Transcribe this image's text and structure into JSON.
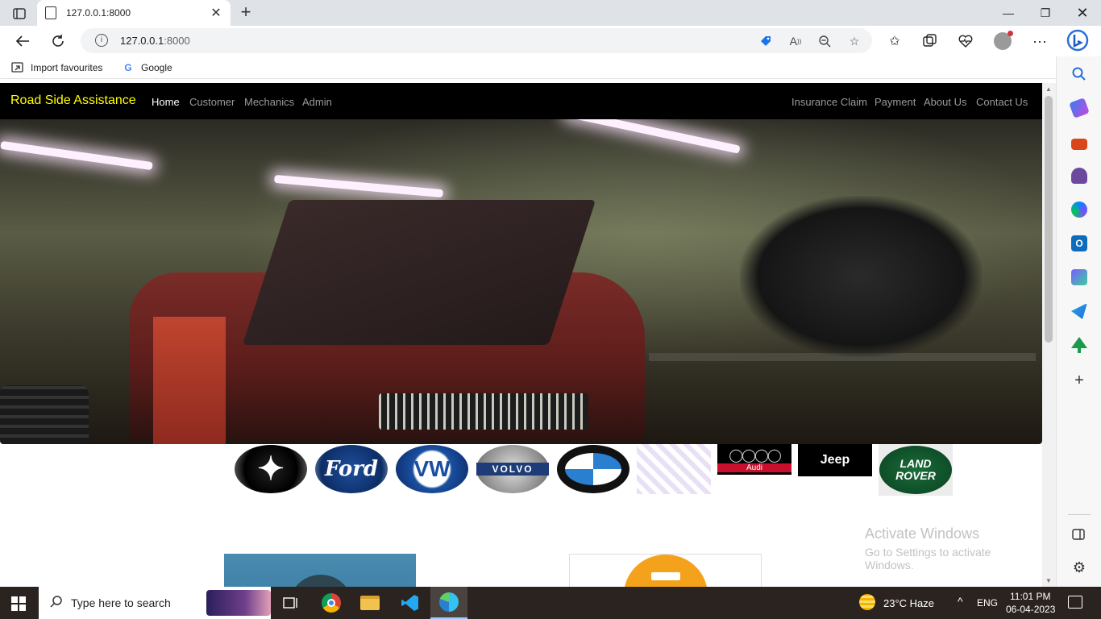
{
  "browser": {
    "tab_title": "127.0.0.1:8000",
    "url_host": "127.0.0.1",
    "url_port": ":8000",
    "favourites": [
      {
        "label": "Import favourites",
        "icon": "import-icon"
      },
      {
        "label": "Google",
        "icon": "google-icon"
      }
    ]
  },
  "site": {
    "brand": "Road Side Assistance",
    "nav_left": [
      "Home",
      "Customer",
      "Mechanics",
      "Admin"
    ],
    "nav_right": [
      "Insurance Claim",
      "Payment",
      "About Us",
      "Contact Us"
    ],
    "active_nav": "Home",
    "brand_color": "#ffff00",
    "logos": {
      "ford": "Ford",
      "volvo": "VOLVO",
      "audi": "Audi",
      "jeep": "Jeep",
      "land_rover_1": "LAND",
      "land_rover_2": "ROVER"
    }
  },
  "watermark": {
    "line1": "Activate Windows",
    "line2": "Go to Settings to activate Windows."
  },
  "taskbar": {
    "search_placeholder": "Type here to search",
    "weather": "23°C  Haze",
    "language": "ENG",
    "time": "11:01 PM",
    "date": "06-04-2023"
  }
}
